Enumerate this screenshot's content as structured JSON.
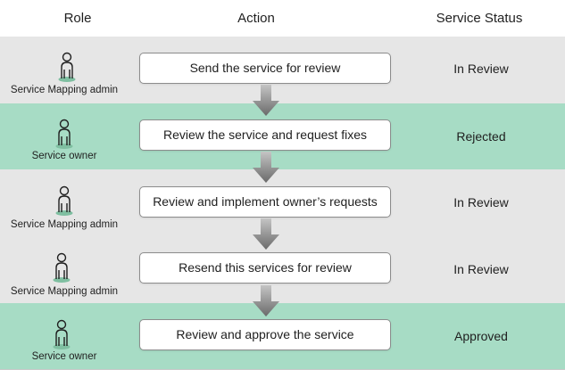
{
  "header": {
    "role": "Role",
    "action": "Action",
    "status": "Service Status"
  },
  "colors": {
    "grey_row": "#e6e6e6",
    "green_row": "#a7dcc5",
    "person_base": "#7fbfa1"
  },
  "rows": [
    {
      "role": "Service Mapping admin",
      "action": "Send the service for review",
      "status": "In Review",
      "band": "grey"
    },
    {
      "role": "Service owner",
      "action": "Review the service and request fixes",
      "status": "Rejected",
      "band": "green"
    },
    {
      "role": "Service Mapping admin",
      "action": "Review and implement owner’s requests",
      "status": "In Review",
      "band": "grey"
    },
    {
      "role": "Service Mapping admin",
      "action": "Resend this services for review",
      "status": "In Review",
      "band": "grey"
    },
    {
      "role": "Service owner",
      "action": "Review and approve the service",
      "status": "Approved",
      "band": "green"
    }
  ],
  "icons": {
    "person": "person-icon",
    "arrow": "arrow-down-icon"
  }
}
